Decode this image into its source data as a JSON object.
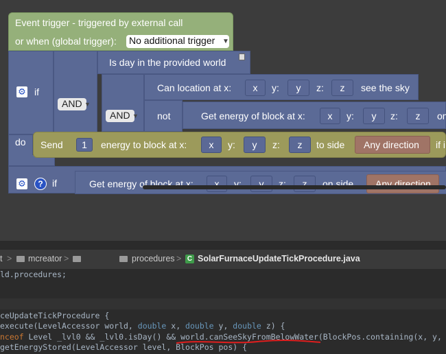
{
  "event": {
    "title": "Event trigger - triggered by external call",
    "or_when": "or when (global trigger):",
    "trigger_value": "No additional trigger"
  },
  "if_block": {
    "if_label": "if",
    "do_label": "do",
    "and1": "AND",
    "and2": "AND",
    "cond1": "Is day in the provided world",
    "cond2_label": "Can location at x:",
    "cond2_y": "y:",
    "cond2_z": "z:",
    "cond2_tail": "see the sky",
    "x": "x",
    "y": "y",
    "z": "z",
    "not_label": "not",
    "energy_label": "Get energy of block at x:",
    "energy_tail": "on"
  },
  "send": {
    "label": "Send",
    "amount": "1",
    "mid": "energy to block at x:",
    "y": "y:",
    "z": "z:",
    "to_side": "to side",
    "direction": "Any direction",
    "tail": "if i"
  },
  "if_block2": {
    "if_label": "if",
    "energy_label": "Get energy of block at x:",
    "y": "y:",
    "z": "z:",
    "on_side": "on side",
    "direction": "Any direction"
  },
  "breadcrumbs": {
    "c0": "t",
    "c1": "mcreator",
    "c2": "procedures",
    "file": "SolarFurnaceUpdateTickProcedure.java"
  },
  "code": {
    "l1": "ld.procedures;",
    "l2": "ceUpdateTickProcedure {",
    "l3a": "execute(LevelAccessor world, ",
    "l3b": "double",
    "l3c": " x, ",
    "l3d": "double",
    "l3e": " y, ",
    "l3f": "double",
    "l3g": " z) {",
    "l4a": "nceof",
    "l4b": " Level _lvl0 && _lvl0.isDay() && world.canSeeSkyFromBelowWater(BlockPos.containing(x, y,",
    "l5": "getEnergyStored(LevelAccessor level, BlockPos pos) {"
  },
  "colors": {
    "event_green": "#95b07a",
    "procedure_blue": "#5b6a96",
    "send_olive": "#9c9a5b",
    "direction_brown": "#a07466",
    "error_underline": "#e01e1e"
  }
}
